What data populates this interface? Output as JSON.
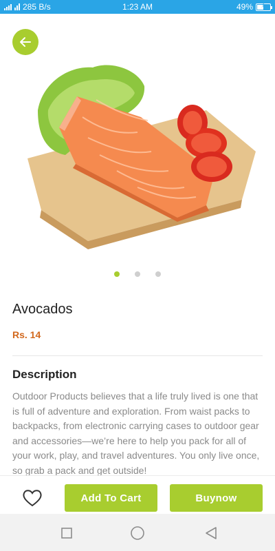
{
  "status_bar": {
    "net_speed": "285 B/s",
    "time": "1:23 AM",
    "battery": "49%",
    "battery_level": 0.49,
    "icons": [
      "signal-icon",
      "wifi-icon",
      "charging-icon"
    ]
  },
  "product": {
    "name": "Avocados",
    "price": "Rs. 14",
    "image_icon": "salmon-on-board-image",
    "carousel": {
      "count": 3,
      "active": 0
    }
  },
  "description": {
    "heading": "Description",
    "text": "Outdoor Products believes that a life truly lived is one that is full of adventure and exploration. From waist packs to backpacks, from electronic carrying cases to outdoor gear and accessories—we’re here to help you pack for all of your work, play, and travel adventures. You only live once, so grab a pack and get outside!"
  },
  "actions": {
    "add_to_cart": "Add To Cart",
    "buy_now": "Buynow"
  },
  "colors": {
    "accent": "#a8cd2f",
    "price": "#d2691e",
    "status_bar": "#2aa5e6"
  }
}
